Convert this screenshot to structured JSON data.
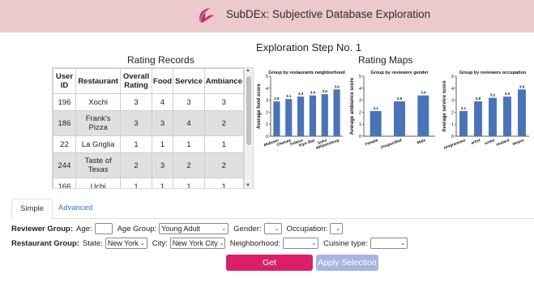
{
  "app": {
    "title": "SubDEx: Subjective Database Exploration"
  },
  "step_title": "Exploration Step No. 1",
  "records": {
    "title": "Rating Records",
    "columns": [
      "User ID",
      "Restaurant",
      "Overall Rating",
      "Food",
      "Service",
      "Ambiance"
    ],
    "rows": [
      [
        "196",
        "Xochi",
        "3",
        "4",
        "3",
        "3"
      ],
      [
        "186",
        "Frank's Pizza",
        "3",
        "3",
        "4",
        "2"
      ],
      [
        "22",
        "La Griglia",
        "1",
        "1",
        "1",
        "1"
      ],
      [
        "244",
        "Taste of Texas",
        "2",
        "3",
        "2",
        "2"
      ],
      [
        "166",
        "Uchi",
        "1",
        "1",
        "1",
        "1"
      ]
    ]
  },
  "maps": {
    "title": "Rating Maps"
  },
  "chart_data": [
    {
      "type": "bar",
      "title": "Group by restaurants neighborhood",
      "ylabel": "Average food score",
      "ylim": [
        0,
        5
      ],
      "categories": [
        "Midtown",
        "Chelsea",
        "Tribeca",
        "Kips Bay",
        "Soho",
        "Williamsburg"
      ],
      "values": [
        2.9,
        3.1,
        3.3,
        3.4,
        3.5,
        3.9
      ],
      "labels": [
        "2.9",
        "3.1",
        "3.3",
        "3.4",
        "3.5",
        "3.9"
      ],
      "color": "#4a74b8"
    },
    {
      "type": "bar",
      "title": "Group by reviewers gender",
      "ylabel": "Average ambiance score",
      "ylim": [
        0,
        5
      ],
      "categories": [
        "Female",
        "Unspecified",
        "Male"
      ],
      "values": [
        2.1,
        2.9,
        3.4
      ],
      "labels": [
        "2.1",
        "2.9",
        "3.4"
      ],
      "color": "#4a74b8"
    },
    {
      "type": "bar",
      "title": "Group by reviewers occupation",
      "ylabel": "Average service score",
      "ylim": [
        0,
        5
      ],
      "categories": [
        "programmer",
        "artist",
        "writer",
        "student",
        "lawyer"
      ],
      "values": [
        2.1,
        2.9,
        3.2,
        3.3,
        3.9
      ],
      "labels": [
        "2.1",
        "2.9",
        "3.2",
        "3.3",
        "3.9"
      ],
      "color": "#4a74b8"
    }
  ],
  "tabs": {
    "simple": "Simple",
    "advanced": "Advanced"
  },
  "reviewer": {
    "label": "Reviewer Group:",
    "age_label": "Age:",
    "age_value": "",
    "age_group_label": "Age Group:",
    "age_group_value": "Young Adult",
    "gender_label": "Gender:",
    "gender_value": "",
    "occupation_label": "Occupation:",
    "occupation_value": ""
  },
  "restaurant": {
    "label": "Restaurant Group:",
    "state_label": "State:",
    "state_value": "New York",
    "city_label": "City:",
    "city_value": "New York City",
    "neighborhood_label": "Neighborhood:",
    "neighborhood_value": "",
    "cuisine_label": "Cuisine type:",
    "cuisine_value": ""
  },
  "buttons": {
    "recommend": "Get Recommendations",
    "apply": "Apply Selection"
  },
  "colors": {
    "banner": "#ecc9cd",
    "bar": "#4a74b8",
    "primary": "#dc1d6a",
    "disabled": "#a9b4e2"
  }
}
